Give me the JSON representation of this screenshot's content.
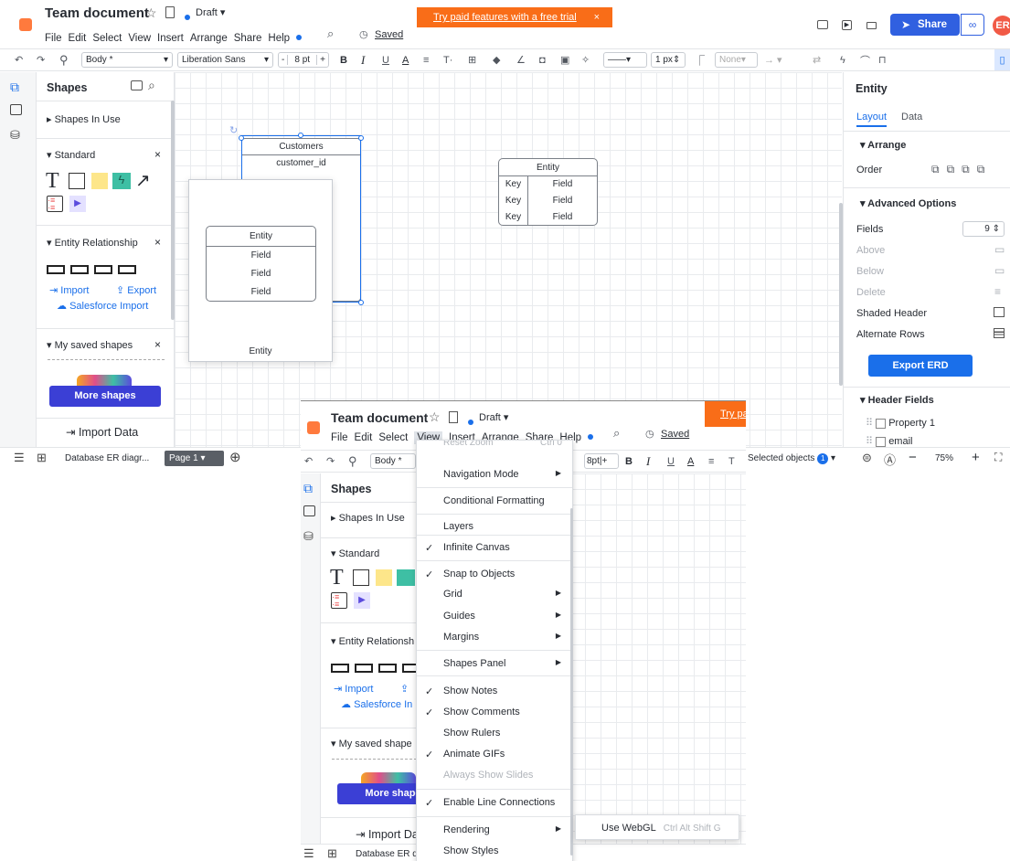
{
  "header": {
    "title": "Team document",
    "status": "Draft",
    "menus": [
      "File",
      "Edit",
      "Select",
      "View",
      "Insert",
      "Arrange",
      "Share",
      "Help"
    ],
    "saved": "Saved",
    "trial": "Try paid features with a free trial",
    "trial_close": "×",
    "share": "Share",
    "avatar": "ER"
  },
  "toolbar": {
    "style": "Body *",
    "font": "Liberation Sans",
    "size": "8 pt",
    "size_minus": "-",
    "size_plus": "+",
    "bold": "B",
    "italic": "I",
    "underline": "U",
    "color": "A",
    "line_width": "1 px",
    "arrow_none": "None"
  },
  "shapes_panel": {
    "title": "Shapes",
    "in_use": "Shapes In Use",
    "standard": "Standard",
    "entity_relationship": "Entity Relationship",
    "import": "Import",
    "export": "Export",
    "salesforce": "Salesforce Import",
    "saved_shapes": "My saved shapes",
    "more_shapes": "More shapes",
    "import_data": "Import Data",
    "close": "×",
    "text_tool": "T"
  },
  "canvas": {
    "customers_title": "Customers",
    "customers_field": "customer_id",
    "entity_title": "Entity",
    "entity_keys": [
      "Key",
      "Key",
      "Key"
    ],
    "entity_fields": [
      "Field",
      "Field",
      "Field"
    ],
    "preview_title": "Entity",
    "preview_fields": [
      "Field",
      "Field",
      "Field"
    ],
    "preview_caption": "Entity"
  },
  "right_panel": {
    "title": "Entity",
    "tab_layout": "Layout",
    "tab_data": "Data",
    "arrange": "Arrange",
    "order": "Order",
    "advanced": "Advanced Options",
    "fields_label": "Fields",
    "fields_value": "9",
    "above": "Above",
    "below": "Below",
    "delete": "Delete",
    "shaded_header": "Shaded Header",
    "alternate_rows": "Alternate Rows",
    "export_erd": "Export ERD",
    "header_fields": "Header Fields",
    "prop1": "Property 1",
    "email": "email"
  },
  "bottom_bar": {
    "doc_name": "Database ER diagr...",
    "page": "Page 1",
    "selected": "Selected objects",
    "selected_count": "1",
    "zoom": "75%",
    "minus": "−",
    "plus": "+"
  },
  "zoom_view": {
    "doc_name": "Database ER d",
    "trial_fragment": "Try pa",
    "size": "8pt",
    "import_fragment": "Import Da",
    "er_fragment": "Entity Relationsh",
    "saved_fragment": "My saved shape",
    "more_fragment": "More shape",
    "salesforce_fragment": "Salesforce In",
    "t_fragment": "T"
  },
  "view_menu": {
    "top_cut": "Reset Zoom",
    "top_cut_short": "Ctrl 0",
    "items": [
      {
        "label": "Navigation Mode",
        "check": false,
        "arrow": true,
        "dim": false
      },
      {
        "label": "Conditional Formatting",
        "check": false,
        "arrow": false,
        "dim": false
      },
      {
        "label": "Layers",
        "check": false,
        "arrow": false,
        "dim": false
      },
      {
        "label": "Infinite Canvas",
        "check": true,
        "arrow": false,
        "dim": false
      },
      {
        "label": "Snap to Objects",
        "check": true,
        "arrow": false,
        "dim": false
      },
      {
        "label": "Grid",
        "check": false,
        "arrow": true,
        "dim": false
      },
      {
        "label": "Guides",
        "check": false,
        "arrow": true,
        "dim": false
      },
      {
        "label": "Margins",
        "check": false,
        "arrow": true,
        "dim": false
      },
      {
        "label": "Shapes Panel",
        "check": false,
        "arrow": true,
        "dim": false
      },
      {
        "label": "Show Notes",
        "check": true,
        "arrow": false,
        "dim": false
      },
      {
        "label": "Show Comments",
        "check": true,
        "arrow": false,
        "dim": false
      },
      {
        "label": "Show Rulers",
        "check": false,
        "arrow": false,
        "dim": false
      },
      {
        "label": "Animate GIFs",
        "check": true,
        "arrow": false,
        "dim": false
      },
      {
        "label": "Always Show Slides",
        "check": false,
        "arrow": false,
        "dim": true
      },
      {
        "label": "Enable Line Connections",
        "check": true,
        "arrow": false,
        "dim": false
      },
      {
        "label": "Rendering",
        "check": false,
        "arrow": true,
        "dim": false
      },
      {
        "label": "Show Styles",
        "check": false,
        "arrow": false,
        "dim": false
      }
    ],
    "submenu_label": "Use WebGL",
    "submenu_shortcut": "Ctrl Alt Shift G"
  }
}
